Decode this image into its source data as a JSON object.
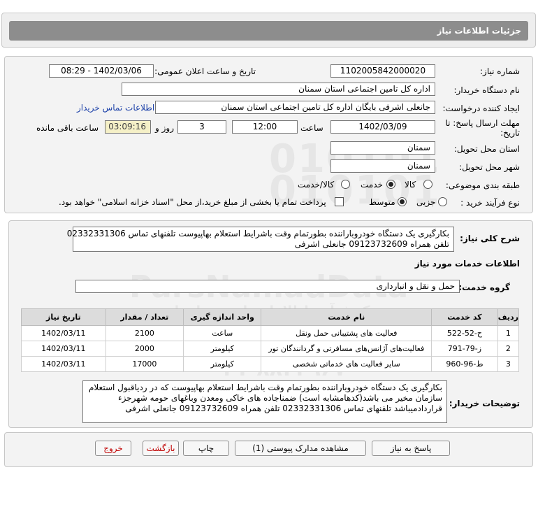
{
  "header": {
    "title": "جزئیات اطلاعات نیاز"
  },
  "form": {
    "need_number_label": "شماره نیاز:",
    "need_number": "1102005842000020",
    "announce_label": "تاریخ و ساعت اعلان عمومی:",
    "announce_value": "1402/03/06 - 08:29",
    "buyer_label": "نام دستگاه خریدار:",
    "buyer_value": "اداره کل تامین اجتماعی استان سمنان",
    "requester_label": "ایجاد کننده درخواست:",
    "requester_value": "جانعلی  اشرفی  بایگان  اداره کل تامین اجتماعی استان سمنان",
    "contact_link": "اطلاعات تماس خریدار",
    "deadline_label_1": "مهلت ارسال پاسخ: تا",
    "deadline_label_2": "تاریخ:",
    "deadline_date": "1402/03/09",
    "time_label": "ساعت",
    "deadline_time": "12:00",
    "days_value": "3",
    "days_label": "روز و",
    "remaining_time": "03:09:16",
    "remaining_label": "ساعت باقی مانده",
    "province_label": "استان محل تحویل:",
    "province_value": "سمنان",
    "city_label": "شهر محل تحویل:",
    "city_value": "سمنان",
    "category_label": "طبقه بندی موضوعی:",
    "category_options": [
      "کالا",
      "خدمت",
      "کالا/خدمت"
    ],
    "category_selected": 1,
    "process_label": "نوع فرآیند خرید :",
    "process_options": [
      "جزیی",
      "متوسط"
    ],
    "process_selected": 1,
    "payment_text": "پرداخت تمام یا بخشی از مبلغ خرید،از محل \"اسناد خزانه اسلامی\" خواهد بود."
  },
  "summary": {
    "label": "شرح کلی نیاز:",
    "line1": "بکارگیری یک دستگاه خودروباراننده بطورتمام وقت باشرایط استعلام بهاپیوست  تلفنهای تماس 02332331306",
    "line2": "تلفن همراه 09123732609 جانعلی اشرفی"
  },
  "services": {
    "section_title": "اطلاعات خدمات مورد نیاز",
    "group_label": "گروه خدمت:",
    "group_value": "حمل و نقل و انبارداری",
    "columns": [
      "ردیف",
      "کد خدمت",
      "نام خدمت",
      "واحد اندازه گیری",
      "تعداد / مقدار",
      "تاریخ نیاز"
    ],
    "rows": [
      [
        "1",
        "ح-52-522",
        "فعالیت های پشتیبانی حمل ونقل",
        "ساعت",
        "2100",
        "1402/03/11"
      ],
      [
        "2",
        "ز-79-791",
        "فعالیت‌های آژانس‌های مسافرتی و گردانندگان تور",
        "کیلومتر",
        "2000",
        "1402/03/11"
      ],
      [
        "3",
        "ط-96-960",
        "سایر فعالیت های خدماتی شخصی",
        "کیلومتر",
        "17000",
        "1402/03/11"
      ]
    ]
  },
  "buyer_notes": {
    "label": "توضیحات خریدار:",
    "line1": "بکارگیری یک دستگاه خودروباراننده بطورتمام وقت باشرایط استعلام بهاپیوست که در ردیاقبول استعلام",
    "line2": "سازمان مخیر می باشد(کدهامشابه است) ضمناجاده های خاکی ومعدن وباغهای حومه شهرجزء",
    "line3": "قراردادمیباشد تلفنهای تماس 02332331306 تلفن همراه 09123732609 جانعلی اشرفی"
  },
  "actions": {
    "reply": "پاسخ به نیاز",
    "view_docs": "مشاهده مدارک پیوستی (1)",
    "print": "چاپ",
    "back": "بازگشت",
    "exit": "خروج"
  },
  "watermark": {
    "number": "010101",
    "brand": "ParsNamadData",
    "caption": "مرکز فرآیند اطلاعات پارس نماد داده",
    "phone": "۰۲۱-۸۸۳۴۹۶۷۰"
  }
}
